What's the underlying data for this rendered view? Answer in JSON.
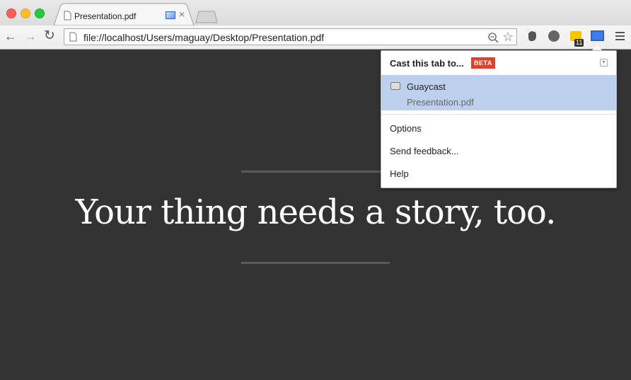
{
  "browser": {
    "tab": {
      "title": "Presentation.pdf",
      "close": "×"
    },
    "nav": {
      "back": "←",
      "forward": "→",
      "reload": "↻"
    },
    "omnibox": {
      "url": "file://localhost/Users/maguay/Desktop/Presentation.pdf"
    },
    "bookmark_star": "☆",
    "extensions": {
      "badge_count": "11"
    }
  },
  "page": {
    "headline": "Your thing needs a story, too."
  },
  "cast_popup": {
    "title": "Cast this tab to...",
    "badge": "BETA",
    "device": {
      "name": "Guaycast",
      "casting": "Presentation.pdf"
    },
    "menu": {
      "options": "Options",
      "feedback": "Send feedback...",
      "help": "Help"
    }
  },
  "colors": {
    "page_bg": "#333333",
    "accent": "#2a66c8",
    "beta": "#d9452c",
    "device_highlight": "#bcd0ee"
  }
}
